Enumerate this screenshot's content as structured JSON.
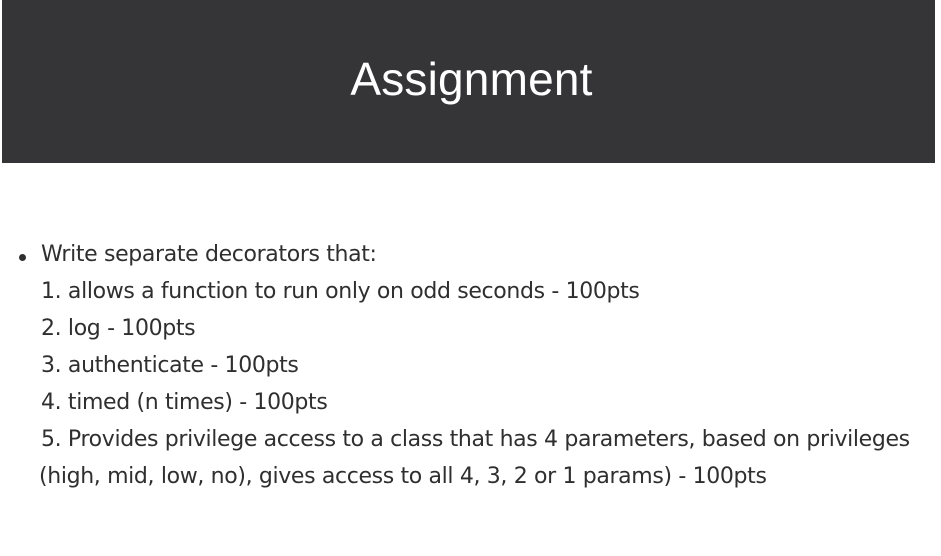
{
  "slide": {
    "title": "Assignment",
    "intro": "Write separate decorators that:",
    "items": [
      "1. allows a function to run only on odd seconds - 100pts",
      "2. log - 100pts",
      "3. authenticate - 100pts",
      "4. timed (n times) - 100pts",
      "5. Provides privilege access to a class that has 4 parameters, based on privileges"
    ],
    "item5_continuation": "(high, mid, low, no), gives access to all 4, 3, 2 or 1 params) - 100pts"
  },
  "colors": {
    "header_bg": "#353537",
    "header_text": "#ffffff",
    "body_text": "#2f2f2f",
    "page_bg": "#ffffff"
  }
}
